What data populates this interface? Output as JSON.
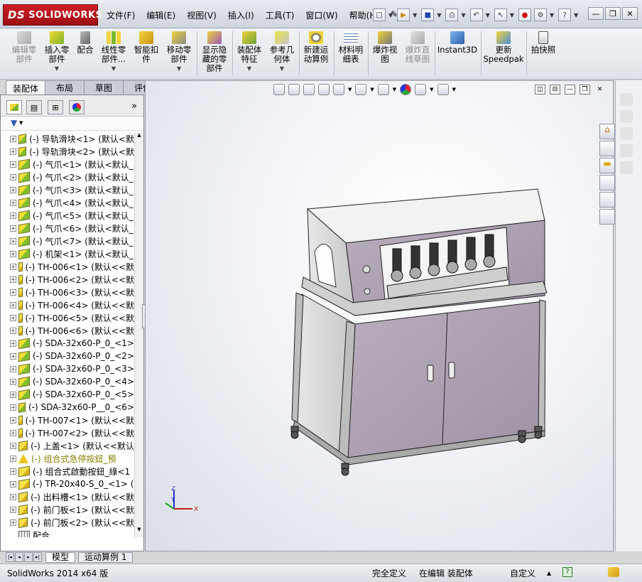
{
  "app": {
    "logo_text": "SOLIDWORKS",
    "logo_mark": "DS"
  },
  "menu": [
    "文件(F)",
    "编辑(E)",
    "视图(V)",
    "插入(I)",
    "工具(T)",
    "窗口(W)",
    "帮助(H)"
  ],
  "ribbon": [
    {
      "label": "编辑零部件",
      "lines": [
        "编辑零",
        "部件"
      ],
      "disabled": true,
      "icon": "edit-component-icon"
    },
    {
      "label": "插入零部件",
      "lines": [
        "插入零",
        "部件"
      ],
      "disabled": false,
      "icon": "insert-component-icon"
    },
    {
      "label": "配合",
      "lines": [
        "配合"
      ],
      "disabled": false,
      "icon": "mate-icon"
    },
    {
      "label": "线性零部件...",
      "lines": [
        "线性零",
        "部件..."
      ],
      "disabled": false,
      "icon": "linear-pattern-icon"
    },
    {
      "label": "智能扣件",
      "lines": [
        "智能扣",
        "件"
      ],
      "disabled": false,
      "icon": "smart-fastener-icon"
    },
    {
      "label": "移动零部件",
      "lines": [
        "移动零",
        "部件"
      ],
      "disabled": false,
      "icon": "move-component-icon"
    },
    {
      "label": "显示隐藏的零部件",
      "lines": [
        "显示隐",
        "藏的零",
        "部件"
      ],
      "disabled": false,
      "icon": "show-hidden-icon"
    },
    {
      "label": "装配体特征",
      "lines": [
        "装配体",
        "特征"
      ],
      "disabled": false,
      "icon": "assembly-feature-icon"
    },
    {
      "label": "参考几何体",
      "lines": [
        "参考几",
        "何体"
      ],
      "disabled": false,
      "icon": "reference-geometry-icon"
    },
    {
      "label": "新建运动算例",
      "lines": [
        "新建运",
        "动算例"
      ],
      "disabled": false,
      "icon": "motion-study-icon"
    },
    {
      "label": "材料明细表",
      "lines": [
        "材料明",
        "细表"
      ],
      "disabled": false,
      "icon": "bom-icon"
    },
    {
      "label": "爆炸视图",
      "lines": [
        "爆炸视",
        "图"
      ],
      "disabled": false,
      "icon": "explode-view-icon"
    },
    {
      "label": "爆炸直线草图",
      "lines": [
        "爆炸直",
        "线草图"
      ],
      "disabled": true,
      "icon": "explode-line-icon"
    },
    {
      "label": "Instant3D",
      "lines": [
        "Instant3D"
      ],
      "disabled": false,
      "icon": "instant3d-icon"
    },
    {
      "label": "更新Speedpak",
      "lines": [
        "更新",
        "Speedpak"
      ],
      "disabled": false,
      "icon": "speedpak-icon"
    },
    {
      "label": "拍快照",
      "lines": [
        "拍快照"
      ],
      "disabled": false,
      "icon": "snapshot-icon"
    }
  ],
  "cm_tabs": [
    "装配体",
    "布局",
    "草图",
    "评估"
  ],
  "tree": [
    "(-) 导轨滑块<1> (默认<默",
    "(-) 导轨滑块<2> (默认<默",
    "(-) 气爪<1> (默认<默认_",
    "(-) 气爪<2> (默认<默认_",
    "(-) 气爪<3> (默认<默认_",
    "(-) 气爪<4> (默认<默认_",
    "(-) 气爪<5> (默认<默认_",
    "(-) 气爪<6> (默认<默认_",
    "(-) 气爪<7> (默认<默认_",
    "(-) 机架<1> (默认<默认_",
    "(-) TH-006<1> (默认<<默",
    "(-) TH-006<2> (默认<<默",
    "(-) TH-006<3> (默认<<默",
    "(-) TH-006<4> (默认<<默",
    "(-) TH-006<5> (默认<<默",
    "(-) TH-006<6> (默认<<默",
    "(-) SDA-32x60-P_0_<1>",
    "(-) SDA-32x60-P_0_<2>",
    "(-) SDA-32x60-P_0_<3>",
    "(-) SDA-32x60-P_0_<4>",
    "(-) SDA-32x60-P_0_<5>",
    "(-) SDA-32x60-P__0_<6>",
    "(-) TH-007<1> (默认<<默",
    "(-) TH-007<2> (默认<<默",
    "(-) 上盖<1> (默认<<默认",
    "(-) 组合式急停按鈕_預",
    "(-) 组合式啟動按鈕_綠<1",
    "(-) TR-20x40-S_0_<1> (",
    "(-) 出料槽<1> (默认<<默",
    "(-) 前门板<1> (默认<<默",
    "(-) 前门板<2> (默认<<默",
    "配合"
  ],
  "tree_types": [
    "g",
    "g",
    "g",
    "g",
    "g",
    "g",
    "g",
    "g",
    "g",
    "g",
    "y",
    "y",
    "y",
    "y",
    "y",
    "y",
    "g",
    "g",
    "g",
    "g",
    "g",
    "g",
    "y",
    "y",
    "y",
    "w",
    "y",
    "y",
    "y",
    "y",
    "y",
    "m"
  ],
  "bottom_tabs": [
    "模型",
    "运动算例 1"
  ],
  "status": {
    "app_version": "SolidWorks 2014 x64 版",
    "definition": "完全定义",
    "editing": "在编辑 装配体",
    "units": "自定义"
  },
  "axes": {
    "x": "X",
    "y": "Y",
    "z": "Z"
  }
}
